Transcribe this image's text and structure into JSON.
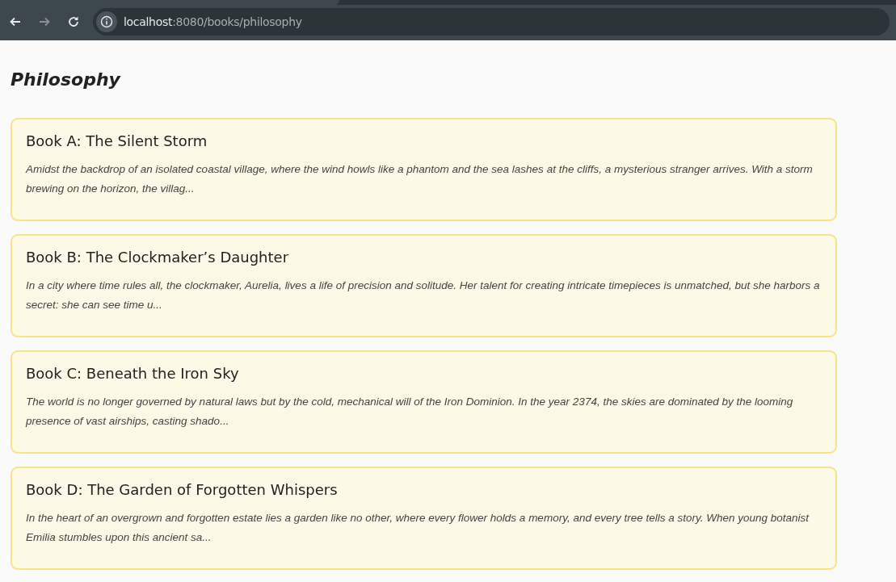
{
  "browser": {
    "url_host": "localhost",
    "url_rest": ":8080/books/philosophy"
  },
  "page": {
    "title": "Philosophy"
  },
  "books": [
    {
      "title": "Book A: The Silent Storm",
      "description": "Amidst the backdrop of an isolated coastal village, where the wind howls like a phantom and the sea lashes at the cliffs, a mysterious stranger arrives. With a storm brewing on the horizon, the villag..."
    },
    {
      "title": "Book B: The Clockmaker’s Daughter",
      "description": "In a city where time rules all, the clockmaker, Aurelia, lives a life of precision and solitude. Her talent for creating intricate timepieces is unmatched, but she harbors a secret: she can see time u..."
    },
    {
      "title": "Book C: Beneath the Iron Sky",
      "description": "The world is no longer governed by natural laws but by the cold, mechanical will of the Iron Dominion. In the year 2374, the skies are dominated by the looming presence of vast airships, casting shado..."
    },
    {
      "title": "Book D: The Garden of Forgotten Whispers",
      "description": "In the heart of an overgrown and forgotten estate lies a garden like no other, where every flower holds a memory, and every tree tells a story. When young botanist Emilia stumbles upon this ancient sa..."
    }
  ]
}
